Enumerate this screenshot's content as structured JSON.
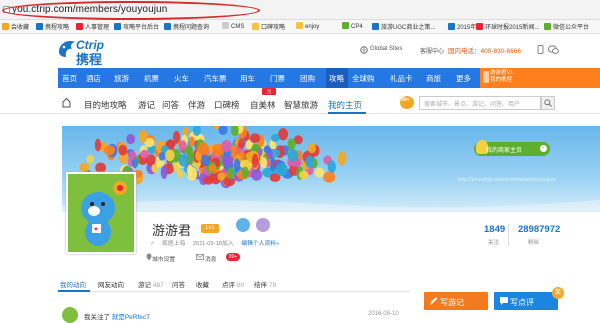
{
  "browser": {
    "url": "you.ctrip.com/members/youyoujun",
    "bookmarks": [
      "会收藏",
      "携程攻略",
      "人事管理",
      "攻略平台后台",
      "携程问题查询",
      "CMS",
      "口碑攻略",
      "enjoy",
      "CP4",
      "旅游UGC商业之策...",
      "2015年...",
      "环球时报2015新闻...",
      "微信公众平台"
    ]
  },
  "header": {
    "logo_en": "Ctrip",
    "logo_cn": "携程",
    "links": [
      "Global Sites",
      "客服中心",
      "我的携程"
    ],
    "phone": "国内电话：400-830-6666"
  },
  "nav": {
    "items": [
      "首页",
      "酒店",
      "旅游",
      "机票",
      "火车",
      "汽车票",
      "用车",
      "门票",
      "团购",
      "攻略",
      "全球购",
      "礼品卡",
      "商旅",
      "更多"
    ],
    "user_line1": "游游君V1",
    "user_line2": "我的携程"
  },
  "subnav": {
    "items": [
      "目的地攻略",
      "游记",
      "问答",
      "伴游",
      "口碑榜",
      "自美林",
      "智慧旅游",
      "我的主页"
    ],
    "badge": "99+",
    "search_placeholder": "搜索城市、景点、游记、问答、用户"
  },
  "banner": {
    "mybiz": "我的商家主页",
    "ghost_url": "http://you.ctrip.com/members/youyoujun"
  },
  "profile": {
    "name": "游游君",
    "level": "Lv1",
    "gender_mark": "♂",
    "location": "现居上海",
    "joined": "2011-03-18加入",
    "intro_link": "编辑个人资料»",
    "city_link": "城市设置",
    "msg_label": "消息",
    "msg_count": "99+",
    "following": "1849",
    "following_label": "关注",
    "followers": "28987972",
    "followers_label": "粉丝"
  },
  "tabs": [
    {
      "label": "我的动向",
      "count": ""
    },
    {
      "label": "网友动向",
      "count": ""
    },
    {
      "label": "游记",
      "count": "487"
    },
    {
      "label": "问答",
      "count": ""
    },
    {
      "label": "收藏",
      "count": ""
    },
    {
      "label": "点评",
      "count": "80"
    },
    {
      "label": "结伴",
      "count": "78"
    }
  ],
  "actions": {
    "write": "写游记",
    "review": "写点评",
    "prize": "奖"
  },
  "feed": {
    "prefix": "我关注了",
    "user": "就是PeRfecT",
    "date": "2016-08-10"
  },
  "colors": {
    "brand_blue": "#2577e3",
    "accent_orange": "#f37b1d",
    "link_blue": "#1a75c7"
  }
}
